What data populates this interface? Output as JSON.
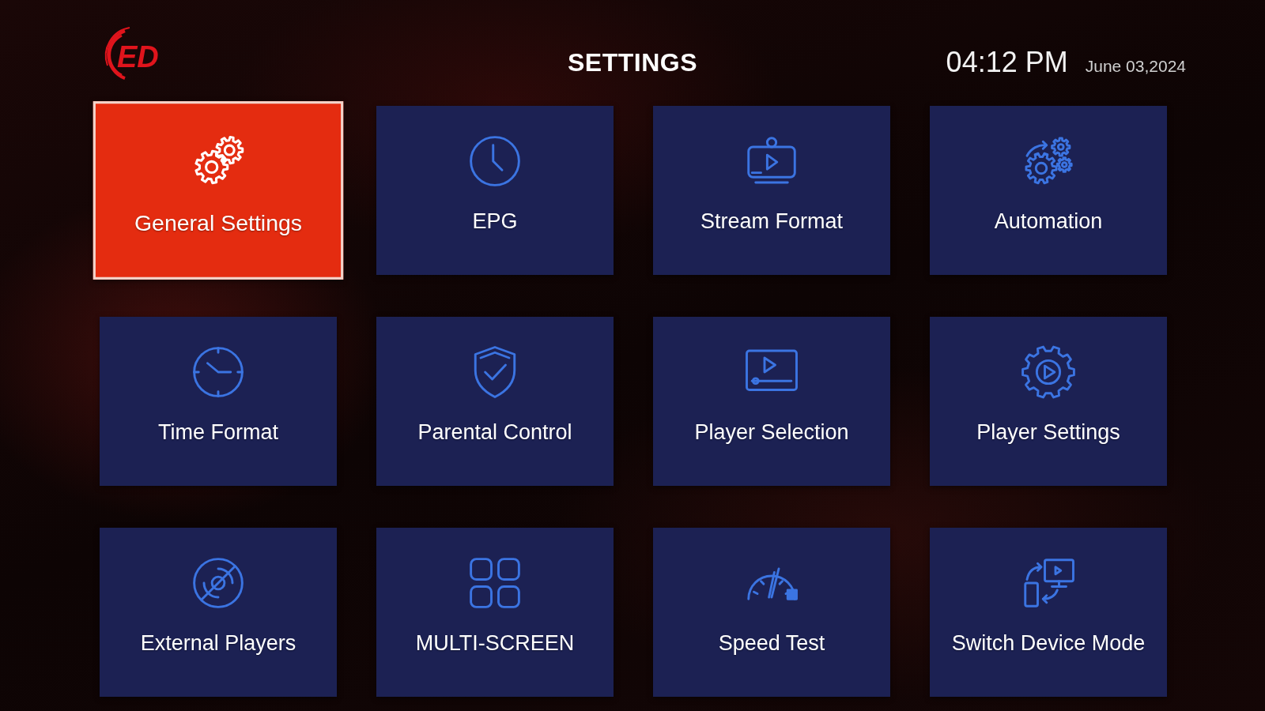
{
  "header": {
    "logo": "ED",
    "title": "SETTINGS",
    "time": "04:12 PM",
    "date": "June 03,2024"
  },
  "tiles": [
    {
      "label": "General Settings",
      "selected": true
    },
    {
      "label": "EPG",
      "selected": false
    },
    {
      "label": "Stream Format",
      "selected": false
    },
    {
      "label": "Automation",
      "selected": false
    },
    {
      "label": "Time Format",
      "selected": false
    },
    {
      "label": "Parental Control",
      "selected": false
    },
    {
      "label": "Player Selection",
      "selected": false
    },
    {
      "label": "Player Settings",
      "selected": false
    },
    {
      "label": "External Players",
      "selected": false
    },
    {
      "label": "MULTI-SCREEN",
      "selected": false
    },
    {
      "label": "Speed Test",
      "selected": false
    },
    {
      "label": "Switch Device Mode",
      "selected": false
    }
  ]
}
